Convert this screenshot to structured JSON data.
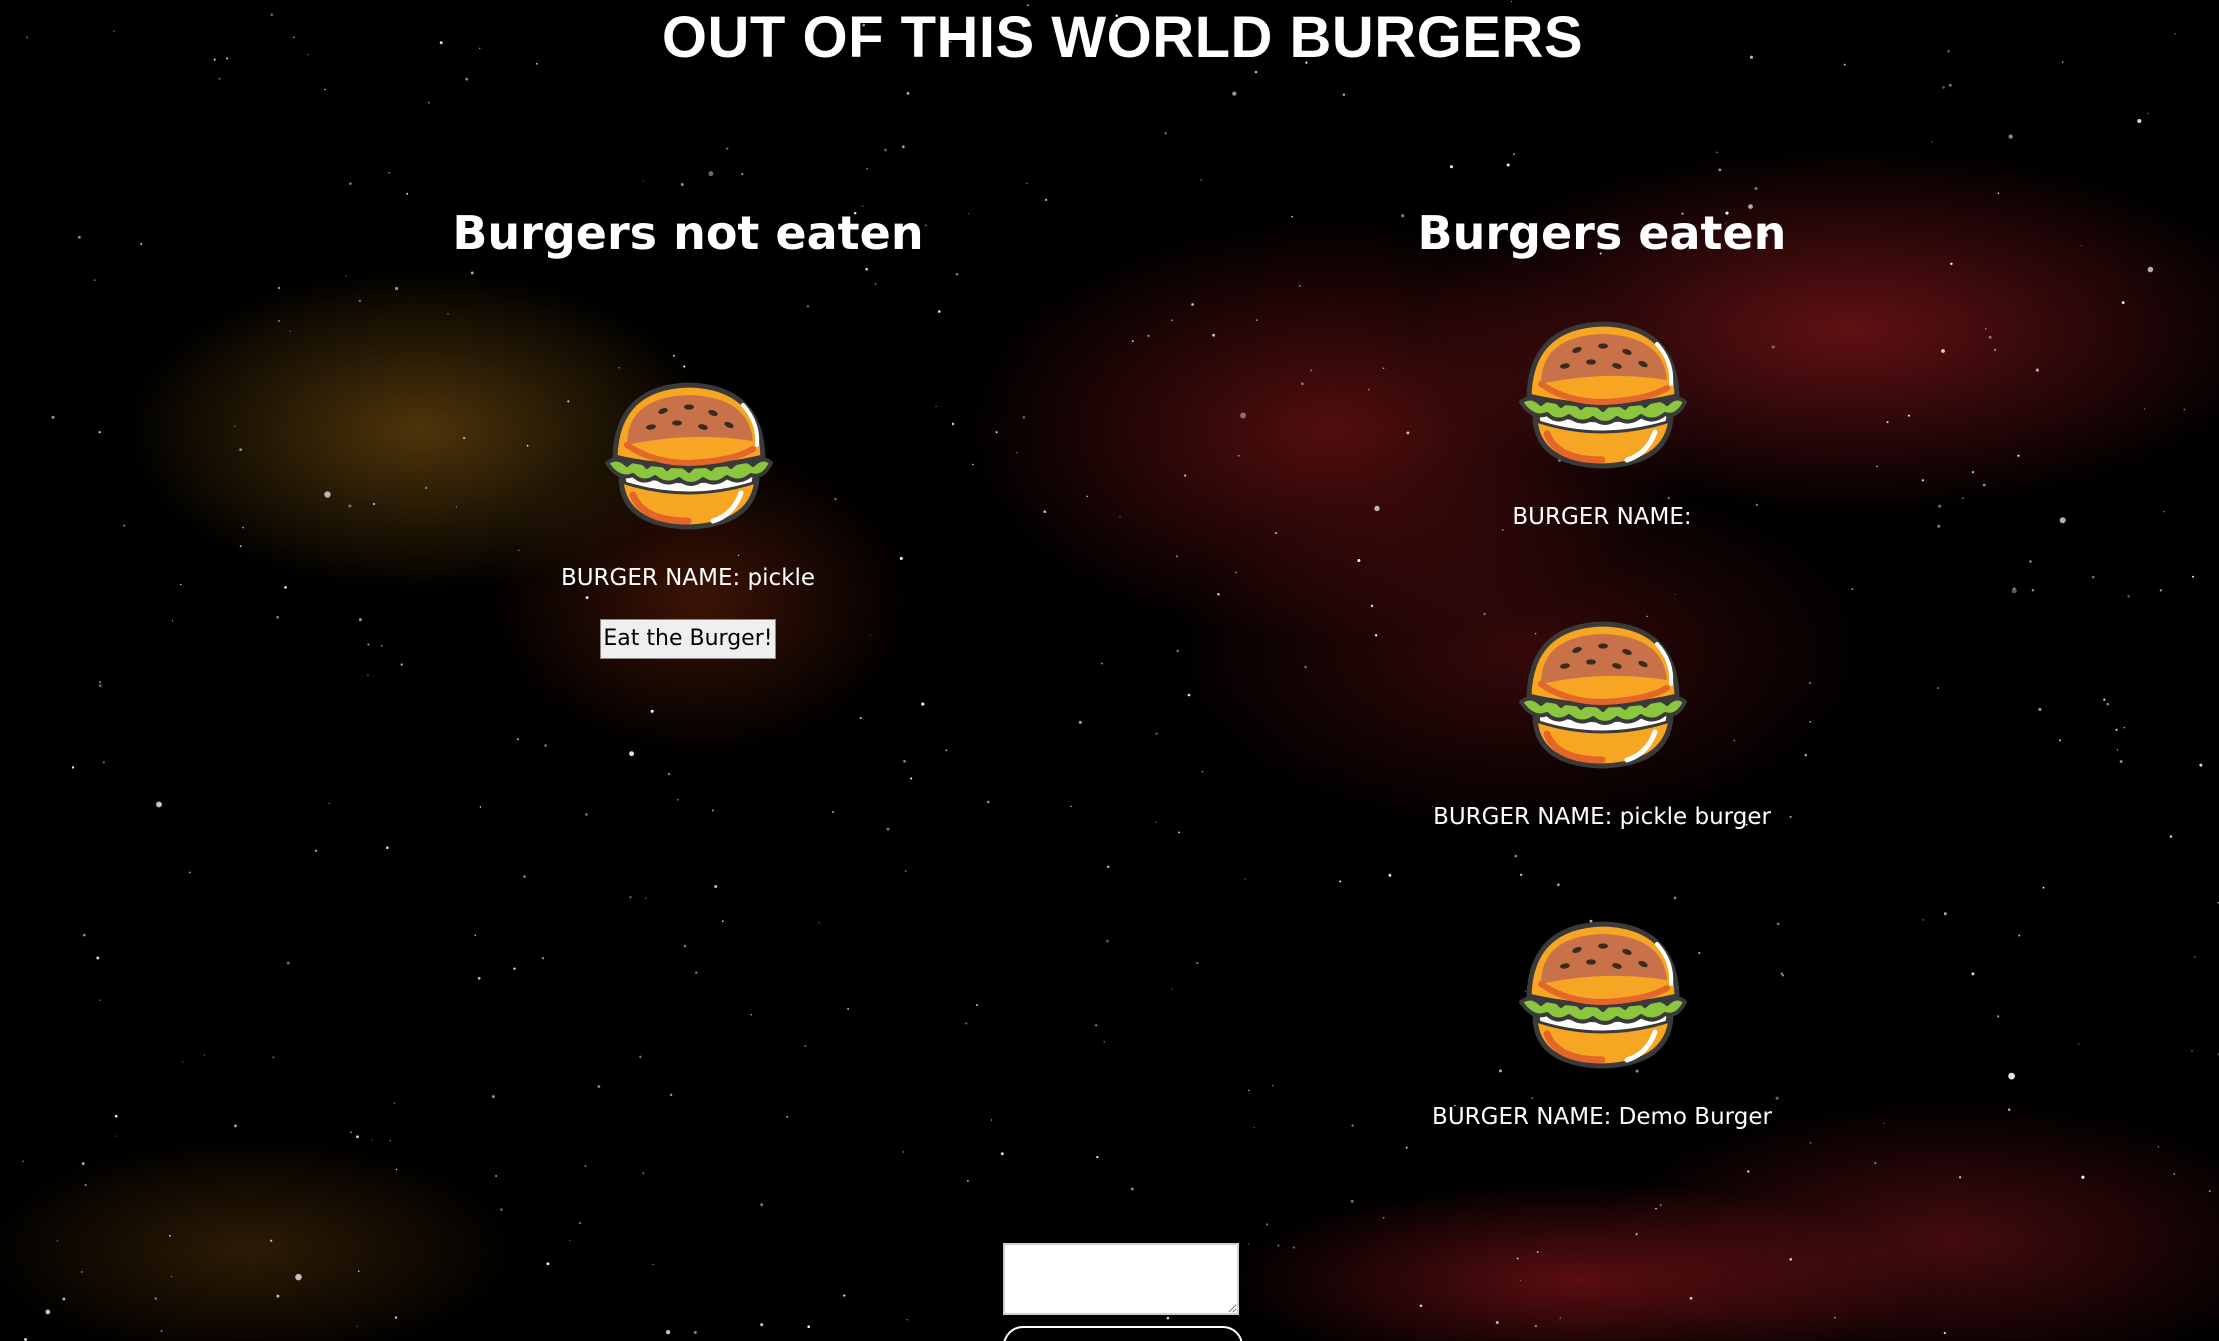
{
  "page": {
    "title": "OUT OF THIS WORLD BURGERS"
  },
  "columns": {
    "not_eaten": {
      "heading": "Burgers not eaten",
      "burgers": [
        {
          "name_label": "BURGER NAME: pickle",
          "button_label": "Eat the Burger!",
          "icon": "burger-icon"
        }
      ]
    },
    "eaten": {
      "heading": "Burgers eaten",
      "burgers": [
        {
          "name_label": "BURGER NAME:",
          "icon": "burger-icon"
        },
        {
          "name_label": "BURGER NAME: pickle burger",
          "icon": "burger-icon"
        },
        {
          "name_label": "BURGER NAME: Demo Burger",
          "icon": "burger-icon"
        }
      ]
    }
  },
  "form": {
    "input_value": "",
    "submit_label": ""
  },
  "colors": {
    "background": "#000000",
    "text": "#ffffff",
    "nebula_red": "#a81c22",
    "nebula_gold": "#7a5212",
    "bun": "#f6a623",
    "lettuce": "#8cc63f"
  }
}
